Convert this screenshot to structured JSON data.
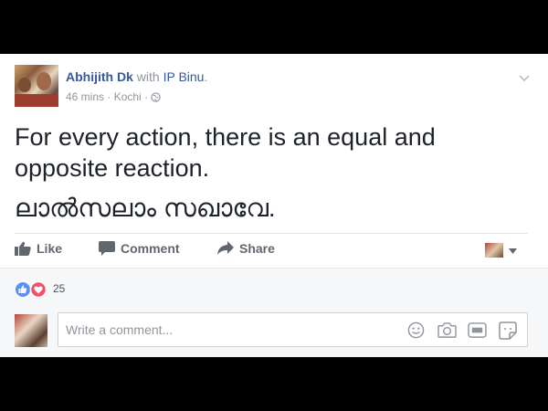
{
  "post": {
    "author": "Abhijith Dk",
    "with_text": " with ",
    "tagged": "IP Binu",
    "tagged_suffix": ".",
    "time": "46 mins",
    "separator": " · ",
    "location": "Kochi",
    "privacy_icon": "globe-icon",
    "text_line1": "For every action, there is an equal and",
    "text_line2": "opposite reaction.",
    "text_line3": "ലാൽസലാം സഖാവേ."
  },
  "actions": {
    "like_label": "Like",
    "comment_label": "Comment",
    "share_label": "Share"
  },
  "reactions": {
    "icons": [
      "like-icon",
      "love-icon"
    ],
    "count": "25"
  },
  "comment": {
    "placeholder": "Write a comment...",
    "icons": [
      "emoji-icon",
      "camera-icon",
      "gif-icon",
      "sticker-icon"
    ]
  },
  "colors": {
    "link": "#365899",
    "like_blue": "#5890ff",
    "love_red": "#f25268",
    "muted": "#90949c"
  }
}
